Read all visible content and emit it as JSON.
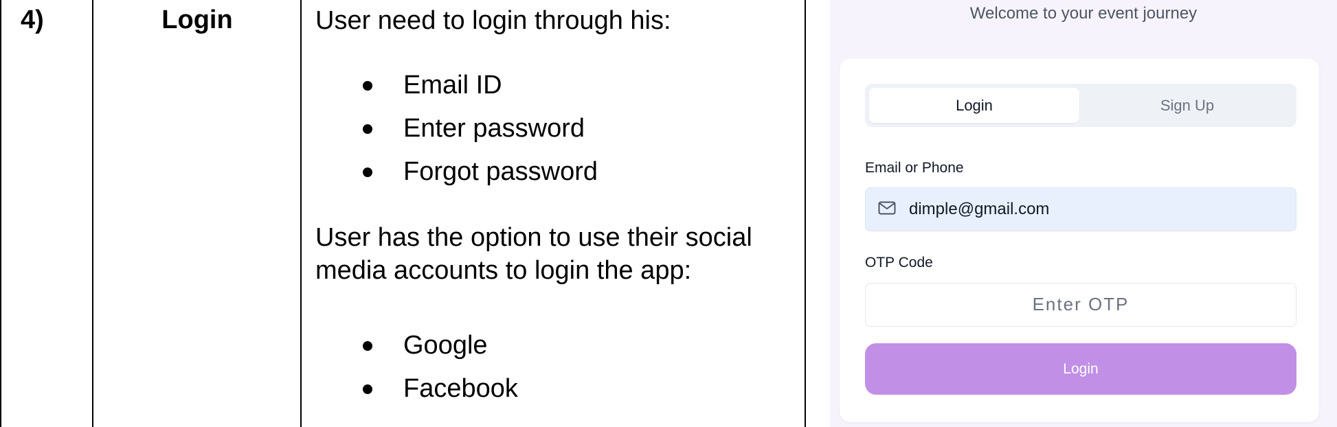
{
  "table": {
    "number": "4)",
    "feature": "Login",
    "intro": "User need to login through his:",
    "login_items": [
      "Email ID",
      "Enter password",
      "Forgot password"
    ],
    "social_text": "User has the option to use their social media accounts to login the app:",
    "social_items": [
      "Google",
      "Facebook"
    ]
  },
  "app": {
    "welcome": "Welcome to your event journey",
    "tabs": {
      "login": "Login",
      "signup": "Sign Up",
      "active": "login"
    },
    "email_label": "Email or Phone",
    "email_icon": "mail-icon",
    "email_value": "dimple@gmail.com",
    "otp_label": "OTP Code",
    "otp_placeholder": "Enter OTP",
    "login_button": "Login",
    "colors": {
      "button": "#c190e6",
      "email_field_bg": "#e9f0fd",
      "tabs_bg": "#eef2f7"
    }
  }
}
